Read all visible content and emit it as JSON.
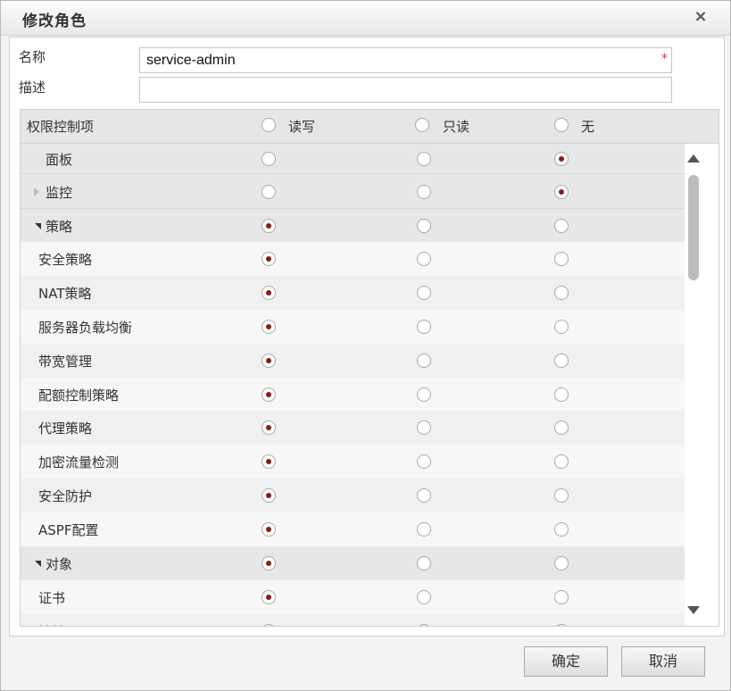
{
  "dialog": {
    "title": "修改角色",
    "close_symbol": "×"
  },
  "form": {
    "name_label": "名称",
    "name_value": "service-admin",
    "required_mark": "*",
    "desc_label": "描述",
    "desc_value": ""
  },
  "table": {
    "header": {
      "label": "权限控制项",
      "read_write": "读写",
      "read_only": "只读",
      "none": "无"
    },
    "rows": [
      {
        "label": "面板",
        "kind": "plain",
        "selected": "none"
      },
      {
        "label": "监控",
        "kind": "collapsed",
        "selected": "none"
      },
      {
        "label": "策略",
        "kind": "expanded",
        "selected": "read_write"
      },
      {
        "label": "安全策略",
        "kind": "child",
        "selected": "read_write"
      },
      {
        "label": "NAT策略",
        "kind": "child",
        "selected": "read_write"
      },
      {
        "label": "服务器负载均衡",
        "kind": "child",
        "selected": "read_write"
      },
      {
        "label": "带宽管理",
        "kind": "child",
        "selected": "read_write"
      },
      {
        "label": "配额控制策略",
        "kind": "child",
        "selected": "read_write"
      },
      {
        "label": "代理策略",
        "kind": "child",
        "selected": "read_write"
      },
      {
        "label": "加密流量检测",
        "kind": "child",
        "selected": "read_write"
      },
      {
        "label": "安全防护",
        "kind": "child",
        "selected": "read_write"
      },
      {
        "label": "ASPF配置",
        "kind": "child",
        "selected": "read_write"
      },
      {
        "label": "对象",
        "kind": "expanded",
        "selected": "read_write"
      },
      {
        "label": "证书",
        "kind": "child",
        "selected": "read_write"
      },
      {
        "label": "地址",
        "kind": "child",
        "selected": "read_write"
      }
    ]
  },
  "footer": {
    "confirm": "确定",
    "cancel": "取消"
  },
  "colors": {
    "selected_dot": "#8b1a1a",
    "group_row_bg": "#e6e6e6",
    "alt_row_bg": "#f0f0f0"
  }
}
